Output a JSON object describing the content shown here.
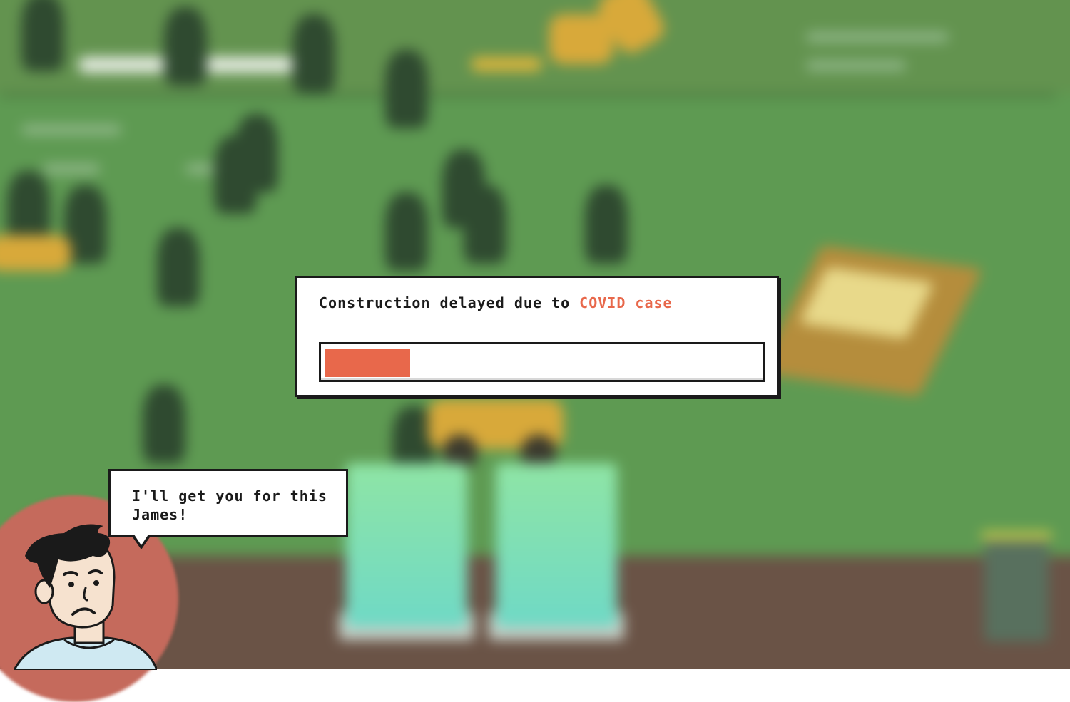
{
  "dialog": {
    "message_prefix": "Construction delayed due to",
    "message_highlight": "COVID case",
    "progress": 0.195,
    "accent_color": "#e8684b"
  },
  "speech_bubble": {
    "text": "I'll get you for this James!"
  },
  "character": {
    "mood": "sad",
    "halo_color": "#c56a5c"
  },
  "background": {
    "state": "blurred",
    "grass_color": "#5e9a52",
    "dirt_color": "#6a5346"
  }
}
